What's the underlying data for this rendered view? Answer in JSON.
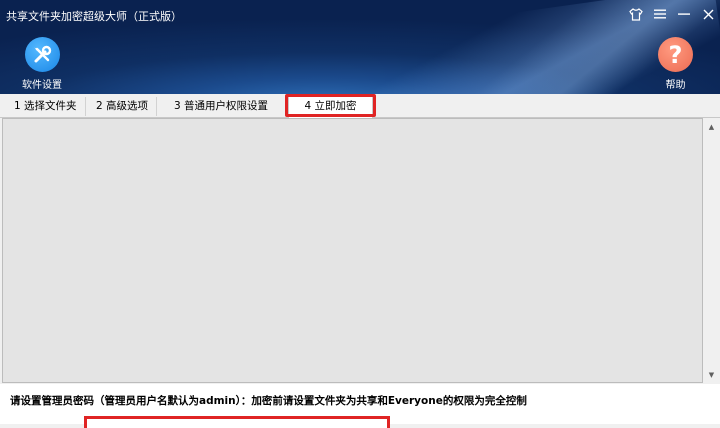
{
  "window": {
    "title": "共享文件夹加密超级大师（正式版）",
    "controls": [
      "shirt-icon",
      "menu-icon",
      "minimize-icon",
      "close-icon"
    ]
  },
  "toolbar": {
    "settings_label": "软件设置",
    "help_label": "帮助"
  },
  "tabs": [
    {
      "label": "1 选择文件夹"
    },
    {
      "label": "2 高级选项"
    },
    {
      "label": "3 普通用户权限设置"
    },
    {
      "label": "4 立即加密",
      "active": true
    }
  ],
  "bottom": {
    "notice": "请设置管理员密码（管理员用户名默认为admin）：加密前请设置文件夹为共享和Everyone的权限为完全控制",
    "password_value": ""
  },
  "colors": {
    "highlight": "#e02424",
    "settings_icon": "#1a86e6",
    "help_icon": "#ec6b52"
  }
}
